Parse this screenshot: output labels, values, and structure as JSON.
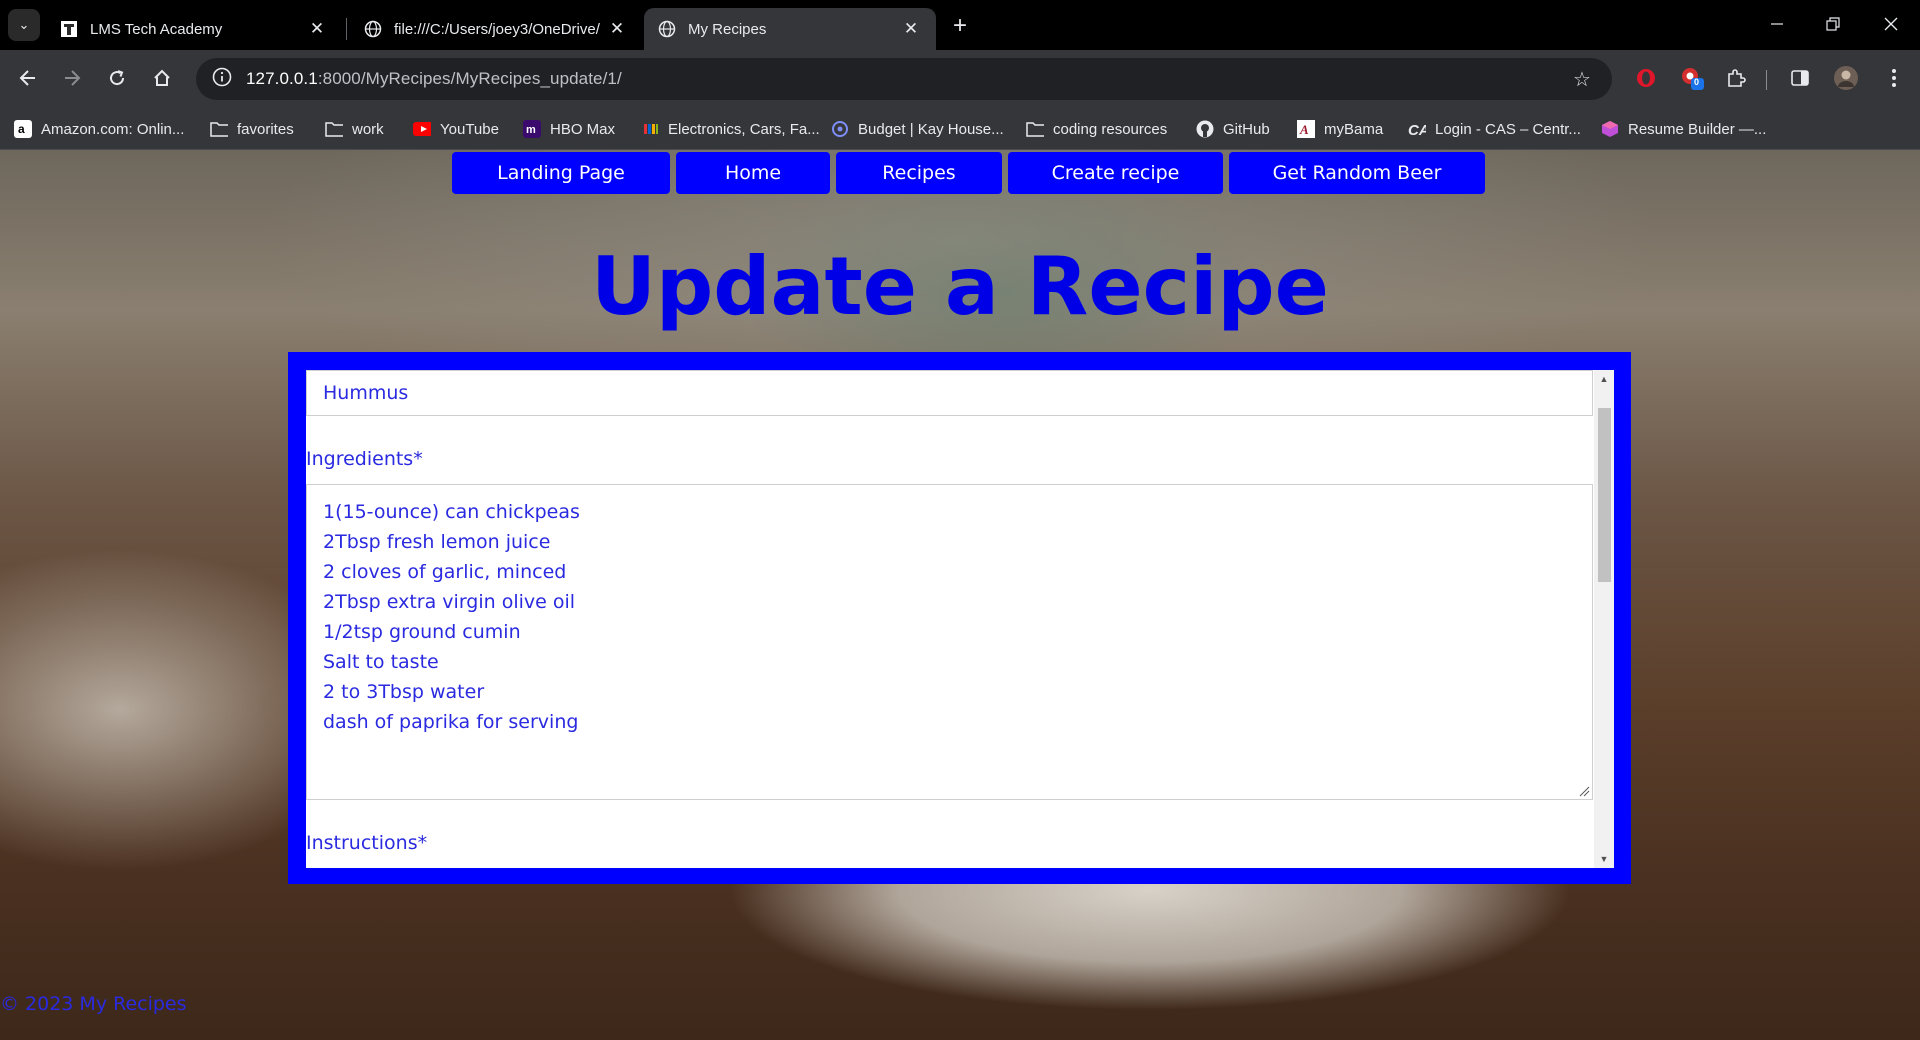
{
  "browser": {
    "tabs": [
      {
        "title": "LMS Tech Academy",
        "active": false
      },
      {
        "title": "file:///C:/Users/joey3/OneDrive/",
        "active": false
      },
      {
        "title": "My Recipes",
        "active": true
      }
    ],
    "url_host": "127.0.0.1",
    "url_path": ":8000/MyRecipes/MyRecipes_update/1/",
    "extension_badge": "0",
    "bookmarks": [
      {
        "label": "Amazon.com: Onlin...",
        "icon": "amazon-icon"
      },
      {
        "label": "favorites",
        "icon": "folder-icon"
      },
      {
        "label": "work",
        "icon": "folder-icon"
      },
      {
        "label": "YouTube",
        "icon": "youtube-icon"
      },
      {
        "label": "HBO Max",
        "icon": "hbo-max-icon"
      },
      {
        "label": "Electronics, Cars, Fa...",
        "icon": "ebay-icon"
      },
      {
        "label": "Budget | Kay House...",
        "icon": "budget-icon"
      },
      {
        "label": "coding resources",
        "icon": "folder-icon"
      },
      {
        "label": "GitHub",
        "icon": "github-icon"
      },
      {
        "label": "myBama",
        "icon": "alabama-icon"
      },
      {
        "label": "Login - CAS – Centr...",
        "icon": "cas-icon"
      },
      {
        "label": "Resume Builder —...",
        "icon": "resume-builder-icon"
      }
    ]
  },
  "nav": {
    "landing": "Landing Page",
    "home": "Home",
    "recipes": "Recipes",
    "create": "Create recipe",
    "beer": "Get Random Beer"
  },
  "page": {
    "title": "Update a Recipe"
  },
  "form": {
    "name_value": "Hummus",
    "ingredients_label": "Ingredients*",
    "ingredients": [
      "1(15-ounce) can chickpeas",
      "2Tbsp fresh lemon juice",
      "2 cloves of garlic, minced",
      "2Tbsp extra virgin olive oil",
      "1/2tsp ground cumin",
      "Salt to taste",
      "2 to 3Tbsp water",
      "dash of paprika for serving"
    ],
    "instructions_label": "Instructions*"
  },
  "footer": {
    "text": "© 2023 My Recipes"
  },
  "colors": {
    "accent": "#0000ff",
    "text_blue": "#2a2ae0"
  }
}
